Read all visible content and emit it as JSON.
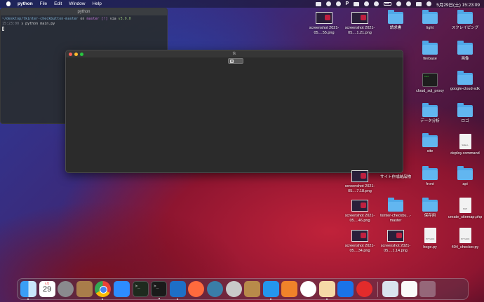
{
  "menubar": {
    "apple": "",
    "app_name": "python",
    "menus": [
      "File",
      "Edit",
      "Window",
      "Help"
    ],
    "status_glyph": "P",
    "clock": "5月29日(土) 15:23:09"
  },
  "terminal": {
    "title": "python",
    "prompt_path": "~/desktop/tkinter-checkbutton-master",
    "prompt_on": "on",
    "prompt_branch": "master [!]",
    "prompt_via": "via",
    "prompt_python": "v3.9.0",
    "time": "15:23:00",
    "command": "❯ python main.py"
  },
  "tk_window": {
    "title": "tk"
  },
  "desktop_icons": [
    {
      "label": "screenshot 2021-05....55.png",
      "kind": "shot"
    },
    {
      "label": "screenshot 2021-05....1.21.png",
      "kind": "shot"
    },
    {
      "label": "請求書",
      "kind": "folder"
    },
    {
      "label": "light",
      "kind": "folder"
    },
    {
      "label": "スクレイピング",
      "kind": "folder"
    },
    {
      "label": "firebase",
      "kind": "folder"
    },
    {
      "label": "画像",
      "kind": "folder"
    },
    {
      "label": "cloud_sql_proxy",
      "kind": "exec"
    },
    {
      "label": "google-cloud-sdk",
      "kind": "folder"
    },
    {
      "label": "データ分析",
      "kind": "folder"
    },
    {
      "label": "ロゴ",
      "kind": "folder"
    },
    {
      "label": "site",
      "kind": "folder"
    },
    {
      "label": "deploy.command",
      "kind": "doc",
      "tag": "SHELL"
    },
    {
      "label": "screenshot 2021-05....7.18.png",
      "kind": "shot"
    },
    {
      "label": "サイト作成納品物",
      "kind": "folder"
    },
    {
      "label": "front",
      "kind": "folder"
    },
    {
      "label": "api",
      "kind": "folder"
    },
    {
      "label": "screenshot 2021-05....46.png",
      "kind": "shot"
    },
    {
      "label": "tkinter-checkbu...-master",
      "kind": "folder"
    },
    {
      "label": "保存用",
      "kind": "folder"
    },
    {
      "label": "create_sitemap.php",
      "kind": "doc",
      "tag": "PHP"
    },
    {
      "label": "screenshot 2021-05....34.png",
      "kind": "shot"
    },
    {
      "label": "screenshot 2021-05....1.14.png",
      "kind": "shot"
    },
    {
      "label": "hoge.py",
      "kind": "doc",
      "tag": "PYTHON"
    },
    {
      "label": "404_checker.py",
      "kind": "doc",
      "tag": "PYTHON"
    }
  ],
  "dock": {
    "calendar_month": "5月",
    "calendar_day": "29",
    "apps": [
      "finder-icon",
      "calendar-icon",
      "system-preferences-icon",
      "notes-brown-icon",
      "chrome-icon",
      "zoom-icon",
      "terminal-green-icon",
      "terminal-icon",
      "vscode-icon",
      "safari-icon",
      "quicktime-icon",
      "disk-utility-icon",
      "archive-utility-icon",
      "docker-icon",
      "network-icon",
      "clock-icon",
      "preview-icon",
      "infinity-icon",
      "timer-icon",
      "photos-icon",
      "document-icon",
      "trash-icon"
    ]
  }
}
